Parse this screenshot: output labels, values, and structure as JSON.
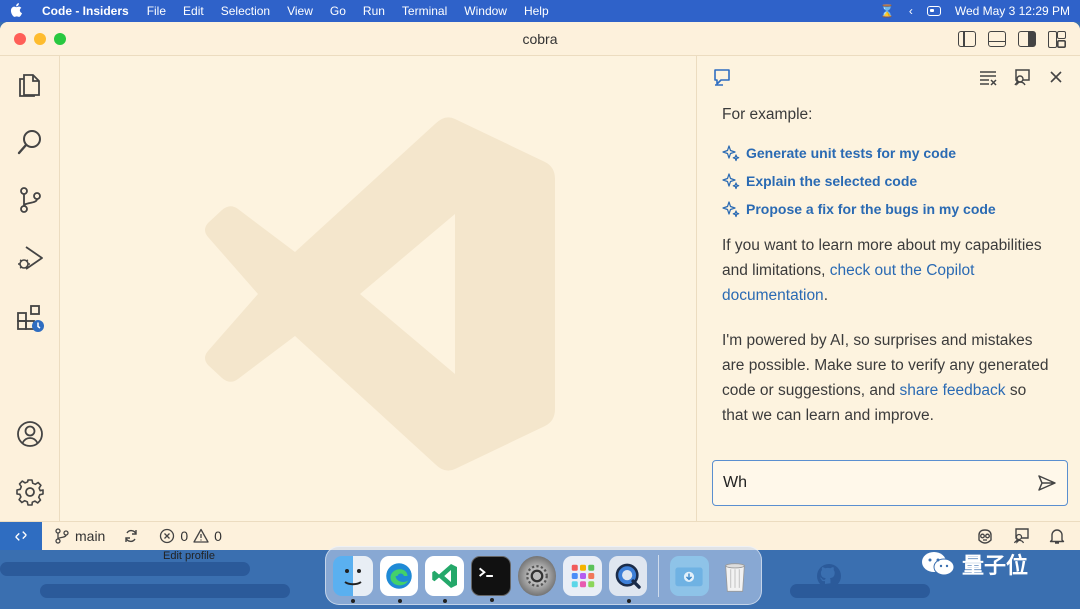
{
  "menubar": {
    "app_name": "Code - Insiders",
    "items": [
      "File",
      "Edit",
      "Selection",
      "View",
      "Go",
      "Run",
      "Terminal",
      "Window",
      "Help"
    ],
    "datetime": "Wed May 3  12:29 PM"
  },
  "window": {
    "title": "cobra"
  },
  "activity_bar": {
    "items": [
      "explorer-icon",
      "search-icon",
      "source-control-icon",
      "run-debug-icon",
      "extensions-icon",
      "account-icon",
      "settings-gear-icon"
    ]
  },
  "chat": {
    "example_heading": "For example:",
    "suggestions": [
      "Generate unit tests for my code",
      "Explain the selected code",
      "Propose a fix for the bugs in my code"
    ],
    "learn_text_1": "If you want to learn more about my capabilities and limitations, ",
    "learn_link": "check out the Copilot documentation",
    "learn_text_2": ".",
    "ai_text_1": "I'm powered by AI, so surprises and mistakes are possible. Make sure to verify any generated code or suggestions, and ",
    "ai_link": "share feedback",
    "ai_text_2": " so that we can learn and improve.",
    "input_value": "Wh"
  },
  "statusbar": {
    "branch": "main",
    "errors": "0",
    "warnings": "0"
  },
  "desktop": {
    "edit_profile": "Edit profile",
    "watermark_text": "量子位"
  },
  "colors": {
    "accent": "#2f6dc1",
    "link": "#2a6ab3",
    "window_bg": "#fdf3df",
    "menubar_bg": "#2f62c9"
  }
}
